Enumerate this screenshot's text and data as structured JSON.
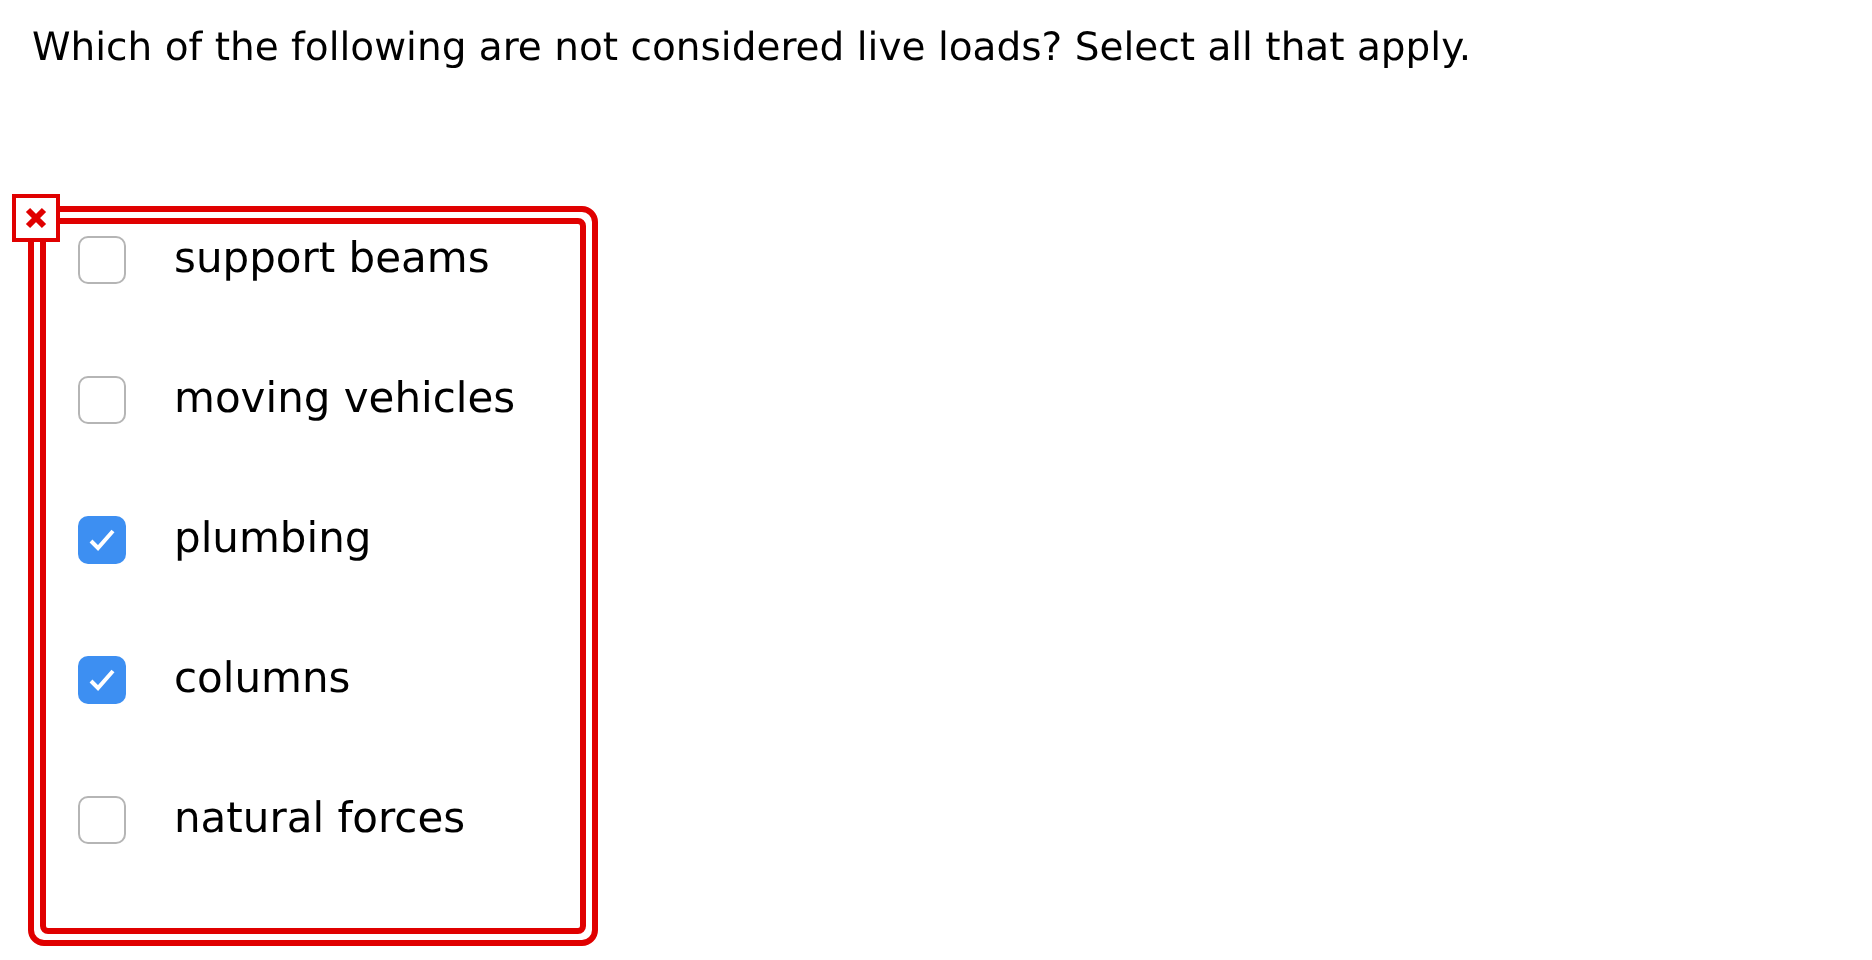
{
  "question": "Which of the following are not considered live loads? Select all that apply.",
  "answer_correct": false,
  "options": [
    {
      "label": "support beams",
      "checked": false
    },
    {
      "label": "moving vehicles",
      "checked": false
    },
    {
      "label": "plumbing",
      "checked": true
    },
    {
      "label": "columns",
      "checked": true
    },
    {
      "label": "natural forces",
      "checked": false
    }
  ]
}
